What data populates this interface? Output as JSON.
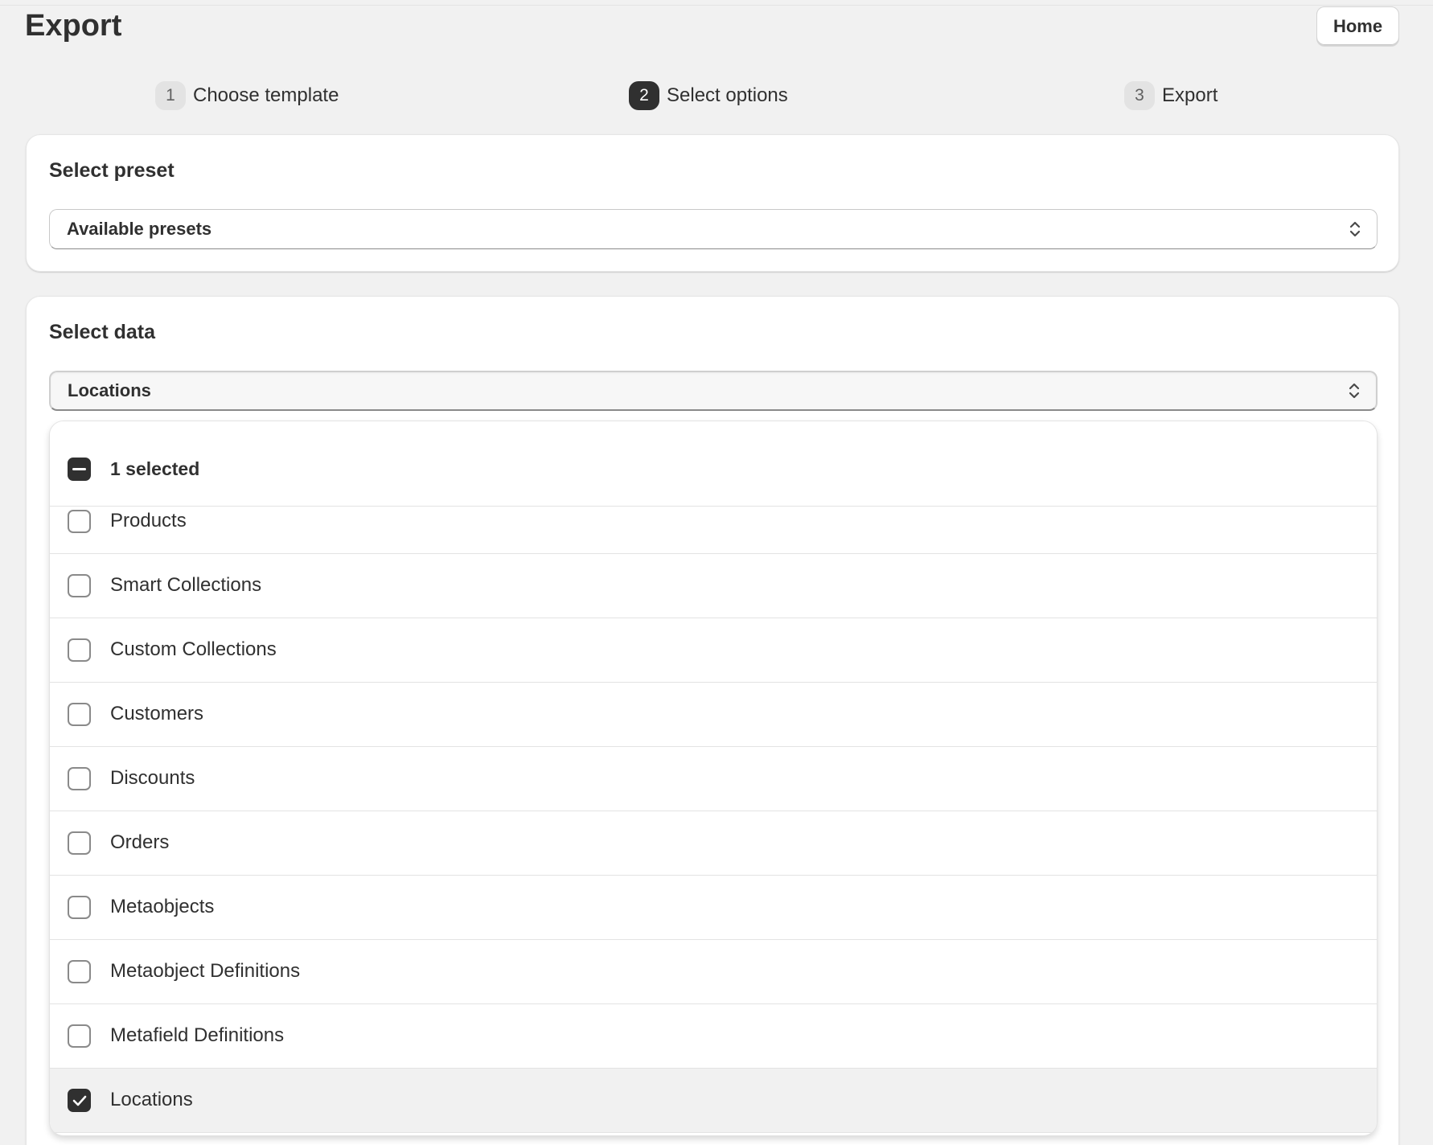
{
  "header": {
    "title": "Export",
    "home_label": "Home"
  },
  "steps": [
    {
      "number": "1",
      "label": "Choose template",
      "active": false
    },
    {
      "number": "2",
      "label": "Select options",
      "active": true
    },
    {
      "number": "3",
      "label": "Export",
      "active": false
    }
  ],
  "preset_card": {
    "title": "Select preset",
    "select_value": "Available presets"
  },
  "data_card": {
    "title": "Select data",
    "select_value": "Locations",
    "list_header_label": "1 selected",
    "items": [
      {
        "label": "Products",
        "checked": false
      },
      {
        "label": "Smart Collections",
        "checked": false
      },
      {
        "label": "Custom Collections",
        "checked": false
      },
      {
        "label": "Customers",
        "checked": false
      },
      {
        "label": "Discounts",
        "checked": false
      },
      {
        "label": "Orders",
        "checked": false
      },
      {
        "label": "Metaobjects",
        "checked": false
      },
      {
        "label": "Metaobject Definitions",
        "checked": false
      },
      {
        "label": "Metafield Definitions",
        "checked": false
      },
      {
        "label": "Locations",
        "checked": true
      }
    ]
  },
  "colors": {
    "background": "#f1f1f1",
    "card": "#ffffff",
    "text": "#303030",
    "active_step": "#303030",
    "inactive_step": "#e3e3e3",
    "selected_row": "#f1f1f1"
  }
}
